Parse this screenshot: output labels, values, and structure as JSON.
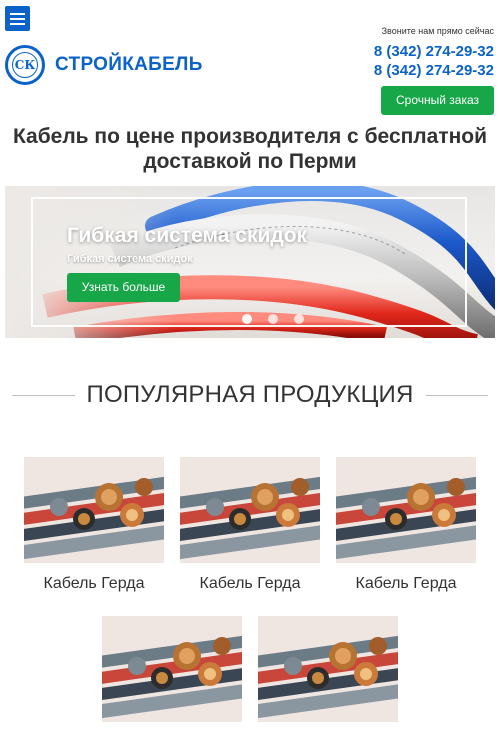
{
  "header": {
    "menu_icon": "hamburger-menu-icon",
    "logo_text": "СТРОЙКАБЕЛЬ",
    "logo_emblem": "СК",
    "call_label": "Звоните нам прямо сейчас",
    "phones": [
      "8 (342) 274-29-32",
      "8 (342) 274-29-32"
    ],
    "order_button": "Срочный заказ",
    "brand_color": "#0b63c9",
    "accent_color": "#17a648"
  },
  "headline": "Кабель по цене производителя с бесплатной доставкой по Перми",
  "banner": {
    "title": "Гибкая система скидок",
    "subtitle": "Гибкая система скидок",
    "button": "Узнать больше",
    "slides_total": 3,
    "active_slide": 1
  },
  "popular": {
    "title": "ПОПУЛЯРНАЯ ПРОДУКЦИЯ",
    "products": [
      {
        "name": "Кабель Герда"
      },
      {
        "name": "Кабель Герда"
      },
      {
        "name": "Кабель Герда"
      },
      {
        "name": ""
      },
      {
        "name": ""
      }
    ]
  }
}
